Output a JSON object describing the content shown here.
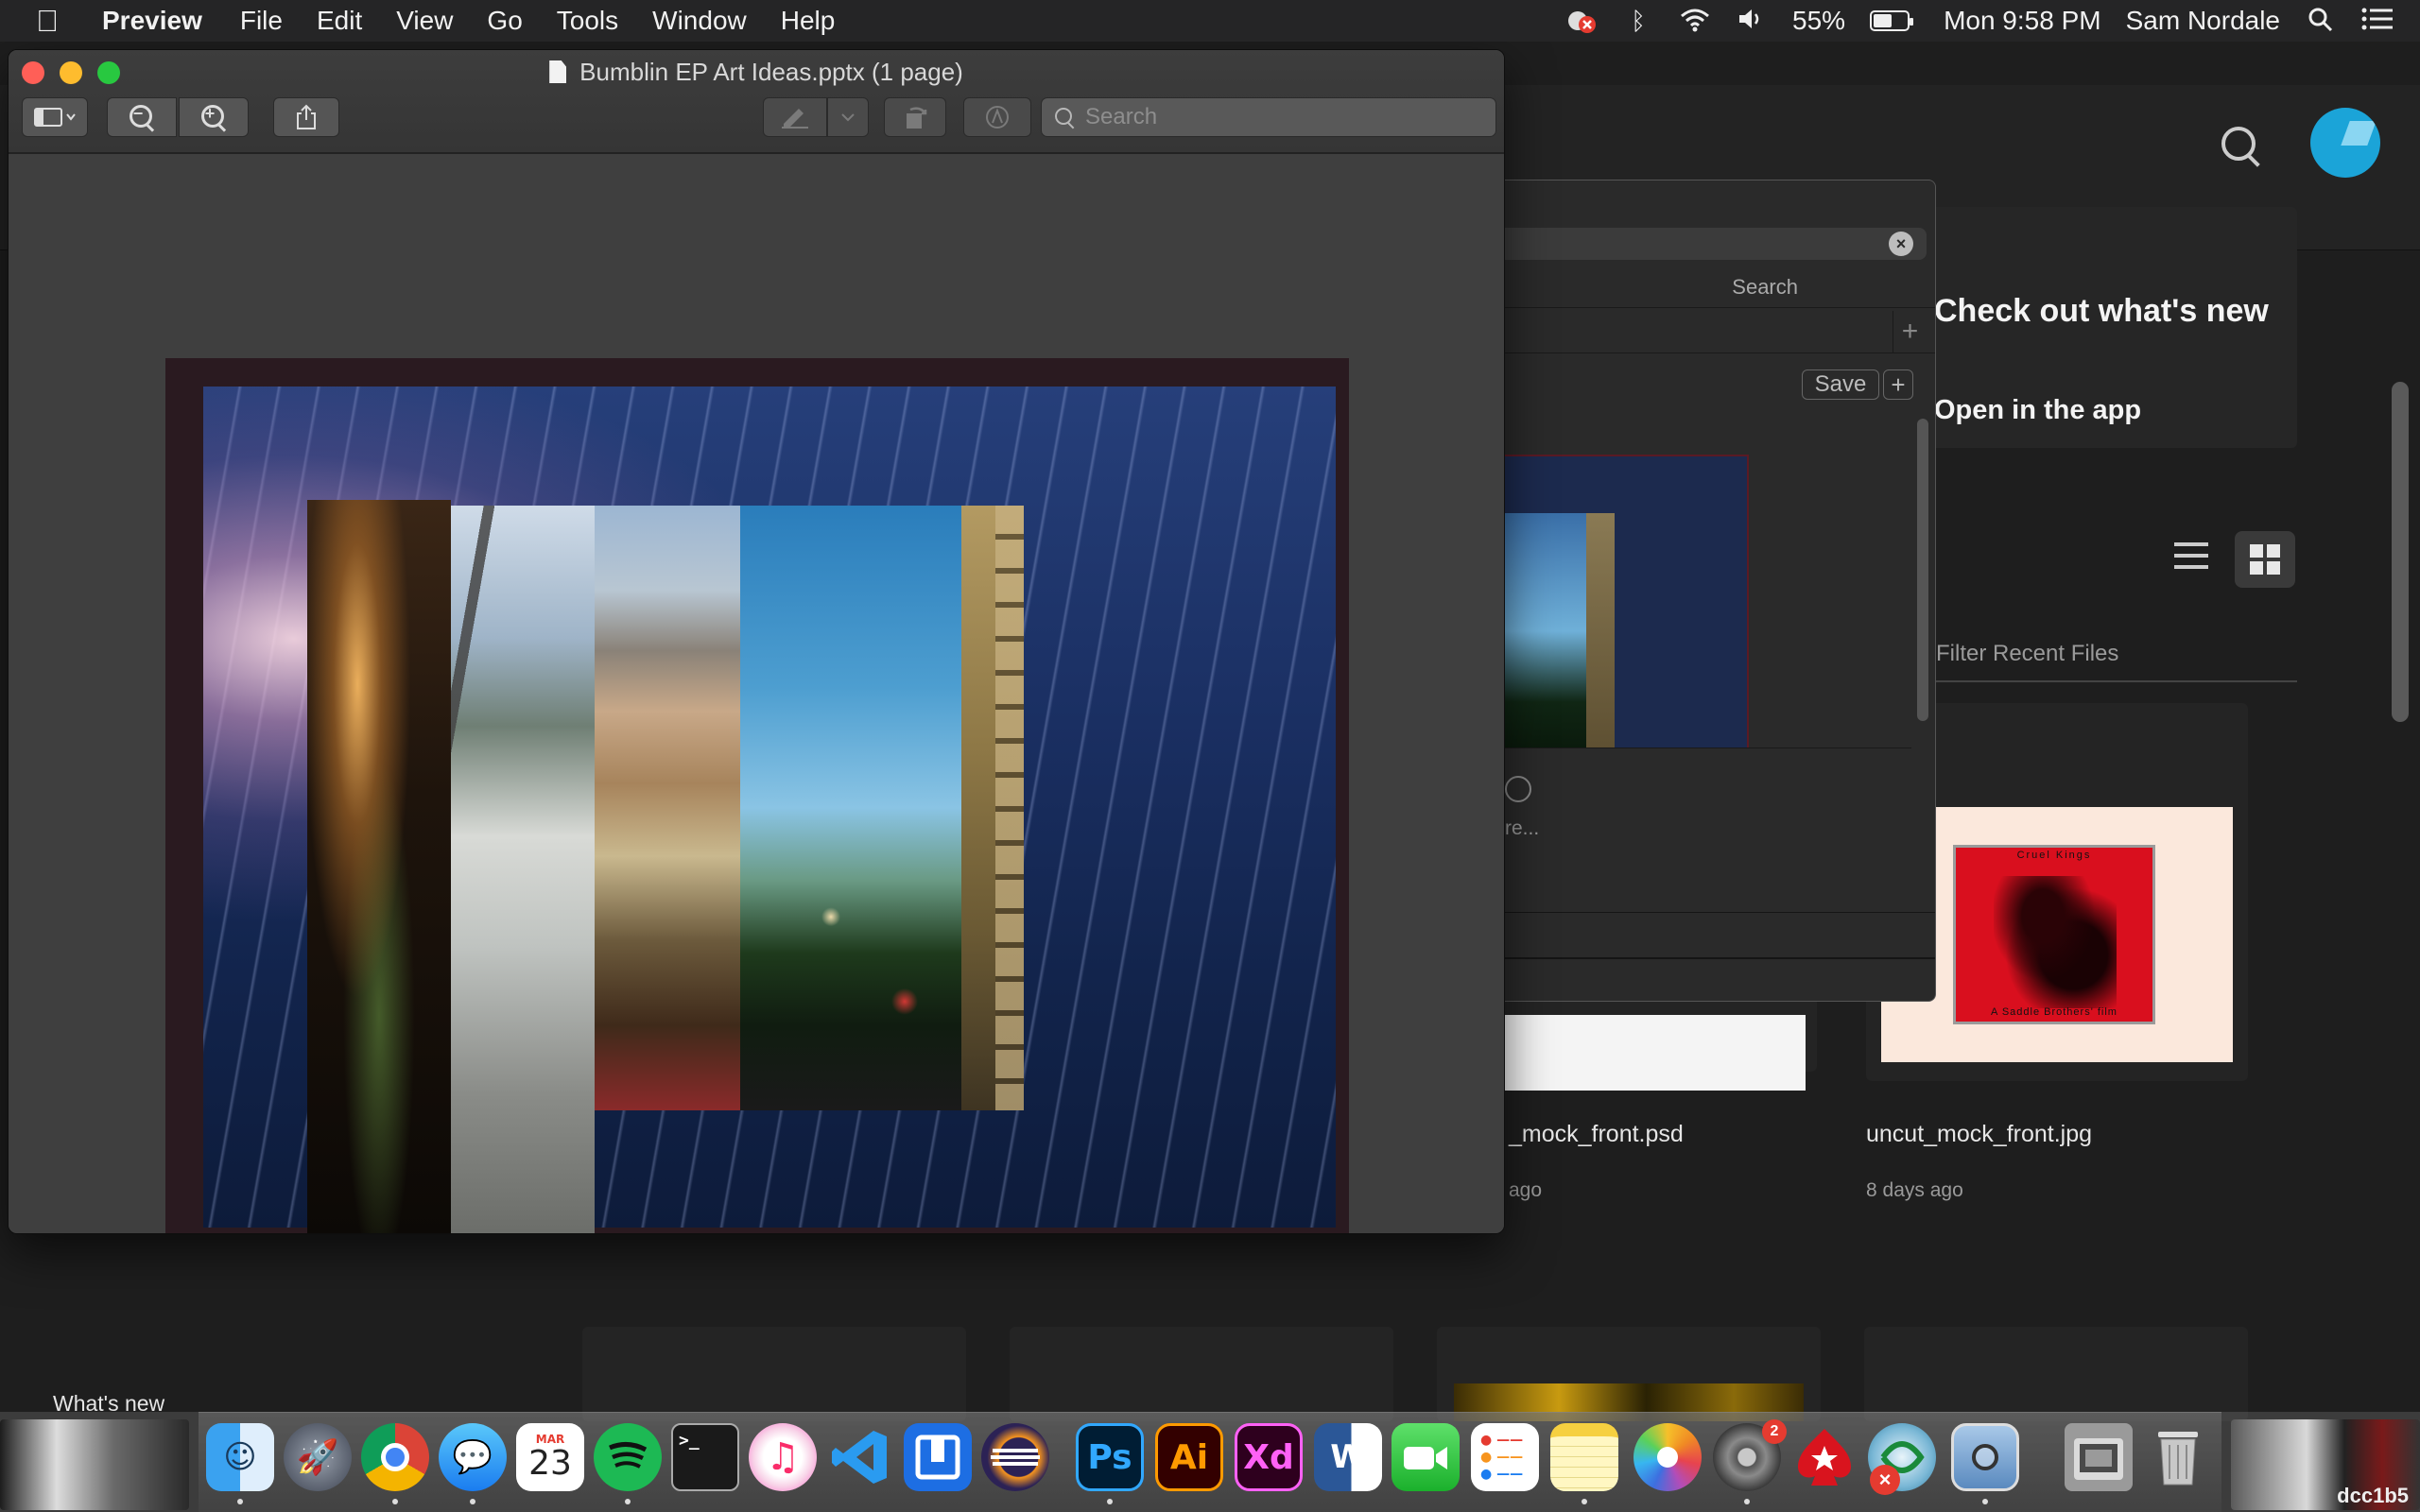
{
  "menubar": {
    "app_name": "Preview",
    "menus": [
      "File",
      "Edit",
      "View",
      "Go",
      "Tools",
      "Window",
      "Help"
    ],
    "battery": "55%",
    "battery_level": 0.55,
    "clock": "Mon 9:58 PM",
    "user": "Sam Nordale"
  },
  "preview": {
    "title": "Bumblin EP Art Ideas.pptx (1 page)",
    "search_placeholder": "Search"
  },
  "panel": {
    "search_label": "Search",
    "save_label": "Save",
    "plus_label": "+",
    "add_label": "+",
    "clear_label": "×",
    "more_label": "re..."
  },
  "background_app": {
    "card_title": "Check out what's new",
    "card_link": "Open in the app",
    "filter_placeholder": "Filter Recent Files",
    "files": [
      {
        "name": "_mock_front.psd",
        "date": "ago"
      },
      {
        "name": "uncut_mock_front.jpg",
        "date": "8 days ago"
      }
    ],
    "cd_top": "Cruel Kings",
    "cd_bottom": "A Saddle Brothers' film",
    "whats_new": "What's new"
  },
  "dock": {
    "calendar_month": "MAR",
    "calendar_day": "23",
    "settings_badge": "2",
    "corner_label": "dcc1b5",
    "apps": [
      "finder",
      "launchpad",
      "chrome",
      "messages",
      "calendar",
      "spotify",
      "terminal",
      "itunes",
      "vscode",
      "sourcetree",
      "eclipse",
      "photoshop",
      "illustrator",
      "xd",
      "word",
      "facetime",
      "reminders",
      "notes",
      "photos",
      "system-preferences",
      "pokerstars",
      "network",
      "preview",
      "downloads",
      "trash"
    ],
    "labels": {
      "ps": "Ps",
      "ai": "Ai",
      "xd": "Xd",
      "w": "W"
    }
  },
  "colors": {
    "menubar_bg": "#252526",
    "window_bg": "#3f3f3f",
    "accent_blue": "#1ba4d8",
    "close": "#ff5f57",
    "minimize": "#febc2e",
    "zoom": "#28c840"
  }
}
